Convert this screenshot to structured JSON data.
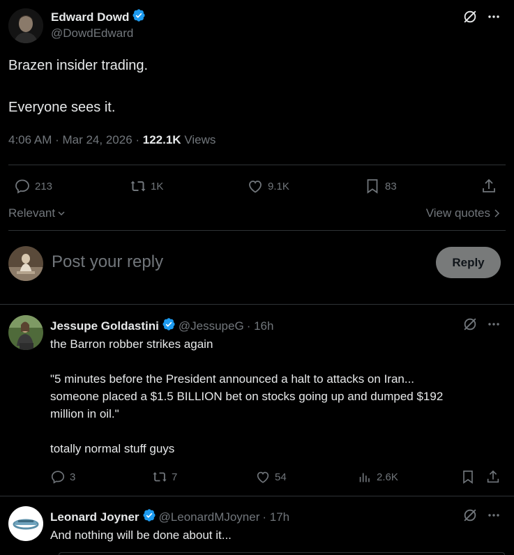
{
  "main_post": {
    "author_name": "Edward Dowd",
    "author_handle": "@DowdEdward",
    "text_line1": "Brazen insider trading.",
    "text_line2": "Everyone sees it.",
    "timestamp": "4:06 AM · Mar 24, 2026 · ",
    "views_count": "122.1K",
    "views_label": " Views",
    "replies": "213",
    "reposts": "1K",
    "likes": "9.1K",
    "bookmarks": "83"
  },
  "filters": {
    "sort_label": "Relevant",
    "view_quotes_label": "View quotes"
  },
  "composer": {
    "placeholder": "Post your reply",
    "reply_button": "Reply"
  },
  "replies": [
    {
      "author_name": "Jessupe Goldastini",
      "author_handle": "@JessupeG",
      "time": "· 16h",
      "line1": "the Barron robber strikes again",
      "line2": "\"5 minutes before the President announced a halt to attacks on Iran...",
      "line3": "someone placed a $1.5 BILLION bet on stocks going up and dumped $192",
      "line4": "million in oil.\"",
      "line5": "totally normal stuff guys",
      "replies": "3",
      "reposts": "7",
      "likes": "54",
      "views": "2.6K"
    },
    {
      "author_name": "Leonard Joyner",
      "author_handle": "@LeonardMJoyner",
      "time": "· 17h",
      "line1": "And nothing will be done about it..."
    }
  ],
  "colors": {
    "background": "#000000",
    "text": "#e7e9ea",
    "muted": "#71767b",
    "verified": "#1d9bf0",
    "divider": "#2f3336",
    "reply_button_bg": "#787a7a"
  }
}
